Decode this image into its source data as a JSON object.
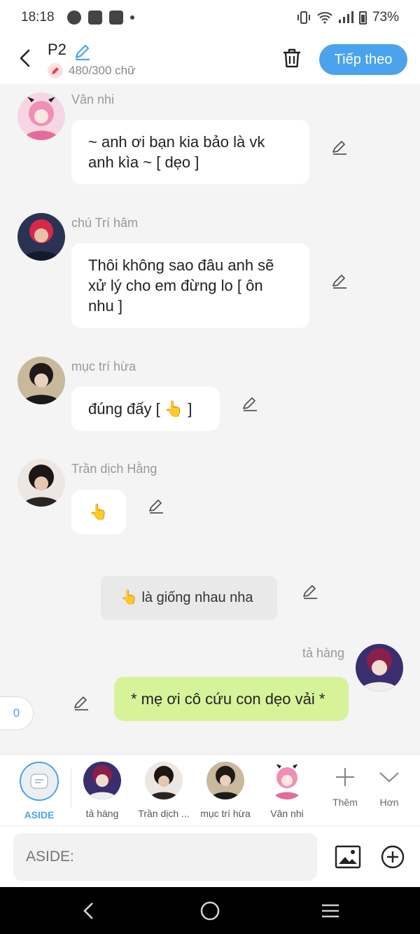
{
  "status_bar": {
    "time": "18:18",
    "battery": "73%"
  },
  "header": {
    "title": "P2",
    "word_count": "480/300 chữ",
    "next_label": "Tiếp theo",
    "accent": "#4aa3ec"
  },
  "messages": [
    {
      "name": "Vân nhi",
      "text": "~ anh ơi bạn kia bảo là vk anh kìa ~ [ dẹo ]"
    },
    {
      "name": "chú Trí hâm",
      "text": "Thôi không sao đâu anh sẽ xử lý cho em đừng lo [ ôn nhu ]"
    },
    {
      "name": "mục trí hừa",
      "text": "đúng đấy [ 👆 ]"
    },
    {
      "name": "Trần dịch Hằng",
      "text": "👆"
    }
  ],
  "aside_message": {
    "text": "👆 là giống nhau nha"
  },
  "self_message": {
    "name": "tả hàng",
    "text": "* mẹ ơi cô cứu con dẹo vải *",
    "color": "#d7f39a"
  },
  "count_chip": "0",
  "character_bar": {
    "aside_label": "ASIDE",
    "characters": [
      {
        "label": "tả hàng"
      },
      {
        "label": "Trần dịch ..."
      },
      {
        "label": "mục trí hừa"
      },
      {
        "label": "Vân nhi"
      }
    ],
    "more_label": "Thêm",
    "collapse_label": "Hơn"
  },
  "input": {
    "placeholder": "ASIDE:"
  }
}
